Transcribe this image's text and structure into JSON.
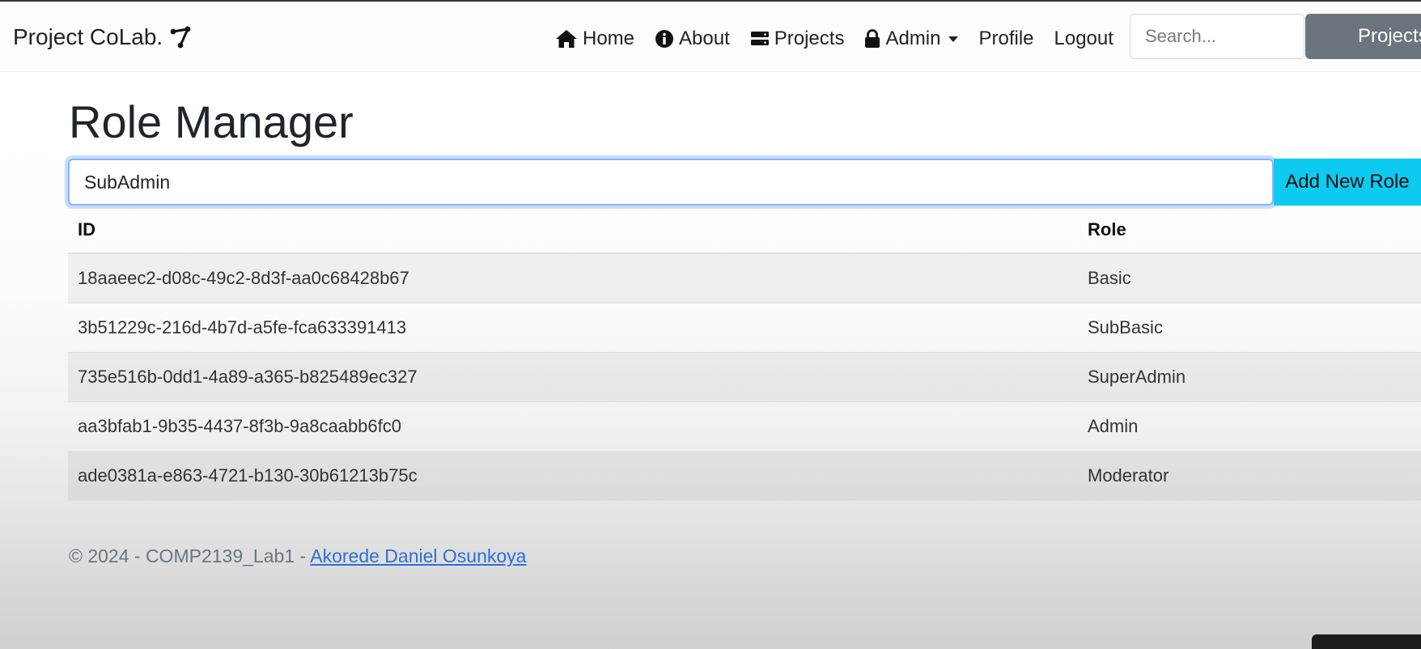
{
  "navbar": {
    "brand": "Project CoLab.",
    "brand_icon": "share-icon",
    "items": [
      {
        "label": "Home",
        "icon": "home-icon"
      },
      {
        "label": "About",
        "icon": "info-icon"
      },
      {
        "label": "Projects",
        "icon": "server-icon"
      },
      {
        "label": "Admin",
        "icon": "lock-icon"
      },
      {
        "label": "Profile"
      },
      {
        "label": "Logout"
      }
    ],
    "search_placeholder": "Search...",
    "projects_button": "Projects"
  },
  "page": {
    "title": "Role Manager",
    "role_input_value": "SubAdmin",
    "add_button": "Add New Role"
  },
  "table": {
    "headers": [
      "ID",
      "Role"
    ],
    "rows": [
      {
        "id": "18aaeec2-d08c-49c2-8d3f-aa0c68428b67",
        "role": "Basic"
      },
      {
        "id": "3b51229c-216d-4b7d-a5fe-fca633391413",
        "role": "SubBasic"
      },
      {
        "id": "735e516b-0dd1-4a89-a365-b825489ec327",
        "role": "SuperAdmin"
      },
      {
        "id": "aa3bfab1-9b35-4437-8f3b-9a8caabb6fc0",
        "role": "Admin"
      },
      {
        "id": "ade0381a-e863-4721-b130-30b61213b75c",
        "role": "Moderator"
      }
    ]
  },
  "footer": {
    "text": "© 2024 - COMP2139_Lab1 - ",
    "link": "Akorede Daniel Osunkoya"
  },
  "colors": {
    "accent": "#0dcaf0",
    "secondary_button": "#6c757d",
    "link": "#2f6fd6",
    "focus_border": "#86b7fe"
  }
}
